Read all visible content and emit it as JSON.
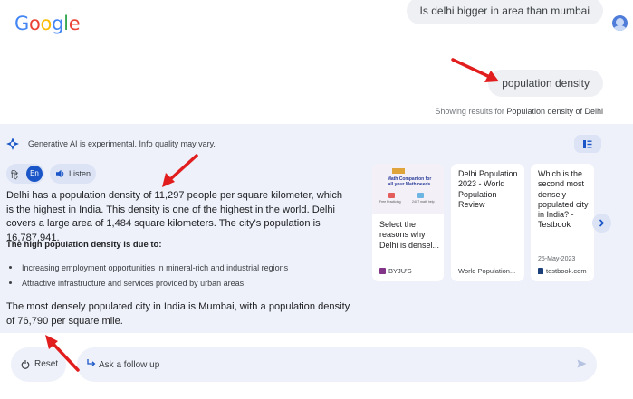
{
  "header": {
    "logo_text": "Google",
    "query_bubble": "Is delhi bigger in area than mumbai",
    "followup_bubble": "population density",
    "showing_prefix": "Showing results for",
    "showing_query": "Population density of Delhi"
  },
  "panel": {
    "ai_notice": "Generative AI is experimental. Info quality may vary.",
    "lang_hi": "हि",
    "lang_en": "En",
    "listen_label": "Listen",
    "paragraph_1": "Delhi has a population density of 11,297 people per square kilometer, which is the highest in India. This density is one of the highest in the world. Delhi covers a large area of 1,484 square kilometers. The city's population is 16,787,941.",
    "subheading": "The high population density is due to:",
    "bullets": [
      "Increasing employment opportunities in mineral-rich and industrial regions",
      "Attractive infrastructure and services provided by urban areas"
    ],
    "paragraph_2": "The most densely populated city in India is Mumbai, with a population density of 76,790 per square mile."
  },
  "cards": [
    {
      "thumb_text": "Math Companion for all your Math needs",
      "thumb_label_1": "Free Practicing",
      "thumb_label_2": "24X7 math help",
      "title": "Select the reasons why Delhi is densel...",
      "source": "BYJU'S"
    },
    {
      "title": "Delhi Population 2023 - World Population Review",
      "source": "World Population..."
    },
    {
      "title": "Which is the second most densely populated city in India? - Testbook",
      "date": "25-May-2023",
      "source": "testbook.com"
    }
  ],
  "bottom": {
    "reset_label": "Reset",
    "followup_placeholder": "Ask a follow up"
  },
  "colors": {
    "panel_bg": "#eef1fa",
    "accent_blue": "#1a56c8",
    "annotation_red": "#e11d1d"
  }
}
